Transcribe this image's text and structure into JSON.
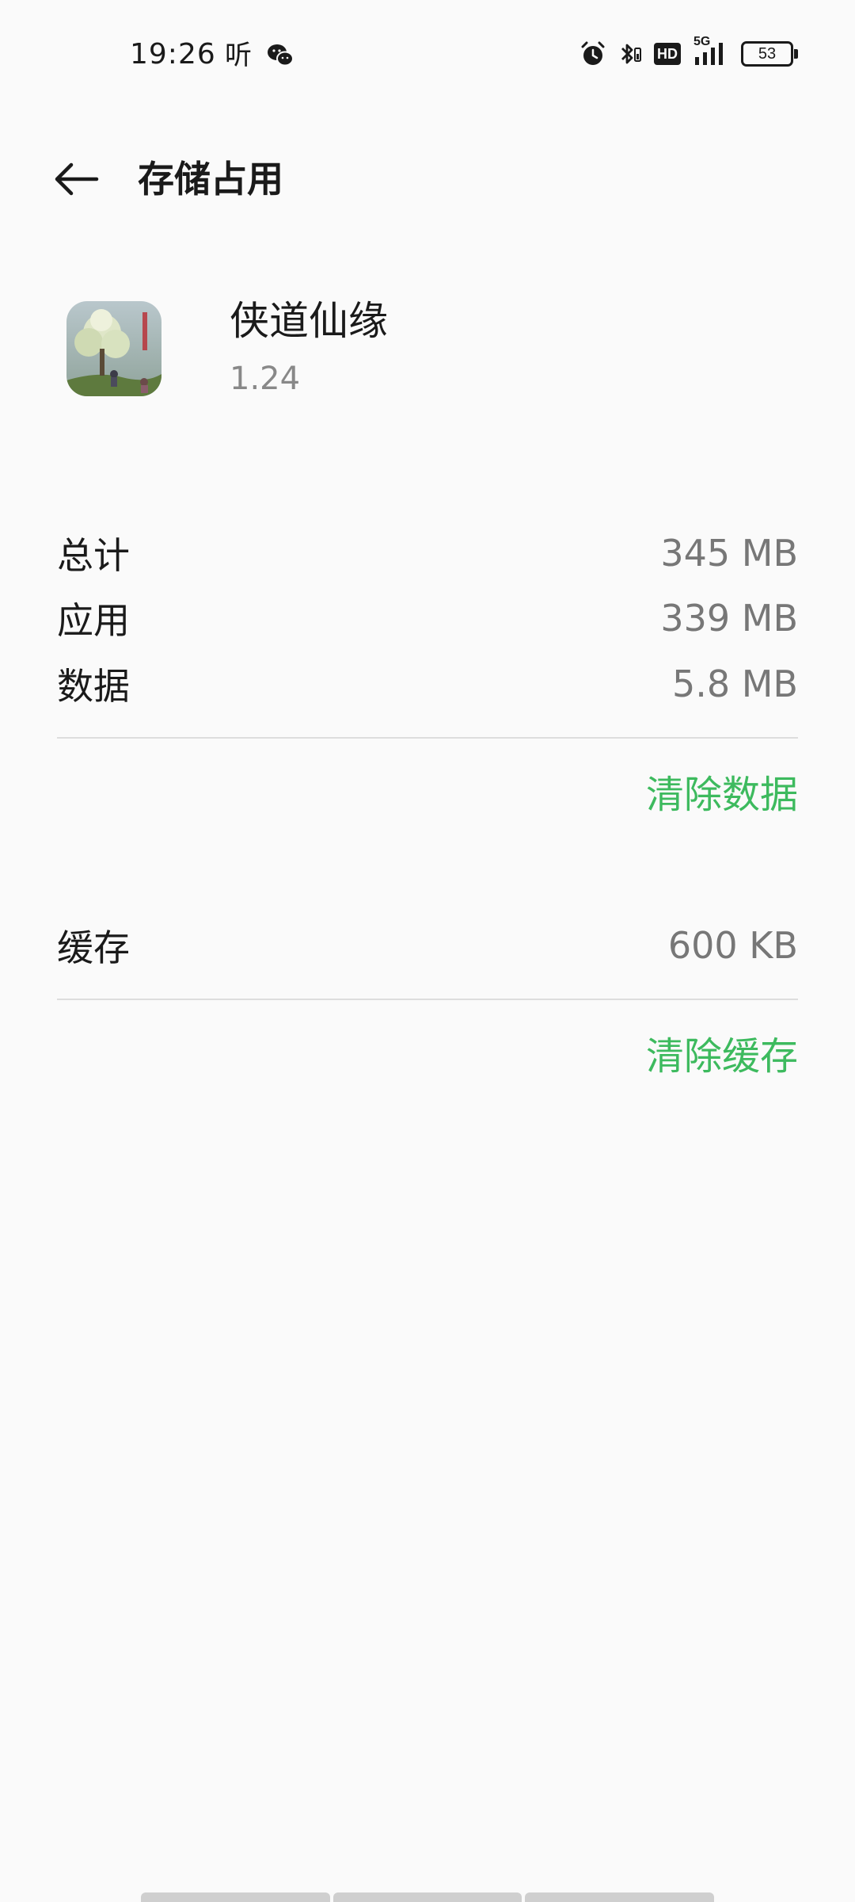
{
  "status_bar": {
    "time": "19:26",
    "ting_glyph": "听",
    "left_icons": [
      "ting-app-icon",
      "wechat-icon"
    ],
    "right_icons": [
      "alarm-icon",
      "bluetooth-icon",
      "hd-icon",
      "signal-5g-icon",
      "battery-icon"
    ],
    "hd_label": "HD",
    "network_label": "5G",
    "battery_level": "53"
  },
  "app_bar": {
    "title": "存储占用",
    "back_icon": "arrow-left-icon"
  },
  "app_info": {
    "name": "侠道仙缘",
    "version": "1.24"
  },
  "storage": {
    "rows": [
      {
        "label": "总计",
        "value": "345 MB"
      },
      {
        "label": "应用",
        "value": "339 MB"
      },
      {
        "label": "数据",
        "value": "5.8 MB"
      }
    ],
    "clear_data_label": "清除数据"
  },
  "cache": {
    "label": "缓存",
    "value": "600 KB",
    "clear_cache_label": "清除缓存"
  },
  "colors": {
    "accent": "#3dba5e",
    "background": "#fafafa",
    "text_primary": "#1a1a1a",
    "text_secondary": "#777777"
  }
}
